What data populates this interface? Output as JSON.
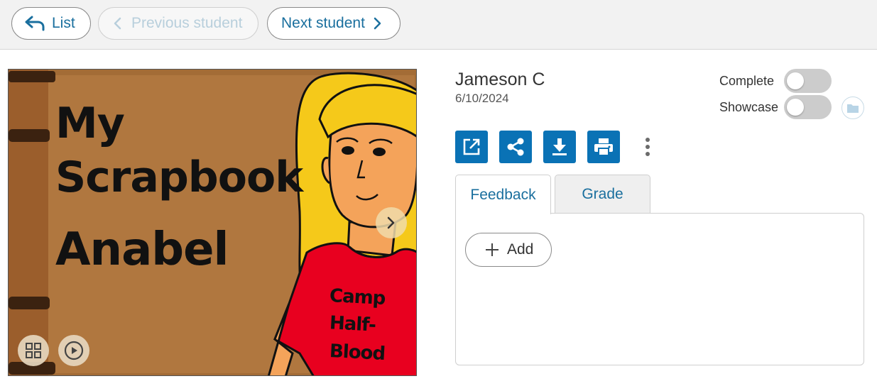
{
  "nav": {
    "list_label": "List",
    "previous_label": "Previous student",
    "next_label": "Next student"
  },
  "slide": {
    "title_lines": [
      "My",
      "Scrapbook",
      "Anabel"
    ],
    "shirt_lines": [
      "Camp",
      "Half-",
      "Blood"
    ],
    "icons": {
      "next": "chevron-right-icon",
      "grid": "grid-view-icon",
      "play": "play-circle-icon"
    }
  },
  "student": {
    "name": "Jameson C",
    "date": "6/10/2024"
  },
  "toggles": {
    "complete_label": "Complete",
    "complete_on": false,
    "showcase_label": "Showcase",
    "showcase_on": false
  },
  "actions": [
    "open-external-icon",
    "share-icon",
    "download-icon",
    "print-icon",
    "more-vertical-icon"
  ],
  "tabs": [
    {
      "label": "Feedback",
      "active": true
    },
    {
      "label": "Grade",
      "active": false
    }
  ],
  "feedback": {
    "add_label": "Add"
  },
  "colors": {
    "accent": "#0a72b5",
    "link": "#1a6f9e",
    "toggle_off": "#cccccc",
    "topbar_bg": "#f2f2f2"
  }
}
